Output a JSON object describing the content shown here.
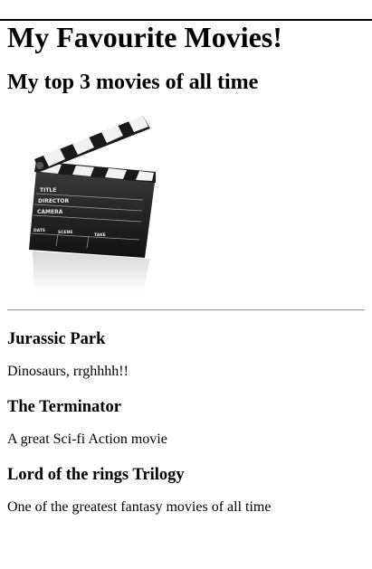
{
  "page": {
    "title": "My Favourite Movies!",
    "subtitle": "My top 3 movies of all time"
  },
  "image": {
    "icon": "clapperboard-icon",
    "slate_labels": {
      "title": "TITLE",
      "director": "DIRECTOR",
      "camera": "CAMERA",
      "date": "DATE",
      "scene": "SCENE",
      "take": "TAKE"
    }
  },
  "movies": [
    {
      "title": "Jurassic Park",
      "description": "Dinosaurs, rrghhhh!!"
    },
    {
      "title": "The Terminator",
      "description": "A great Sci-fi Action movie"
    },
    {
      "title": "Lord of the rings Trilogy",
      "description": "One of the greatest fantasy movies of all time"
    }
  ]
}
